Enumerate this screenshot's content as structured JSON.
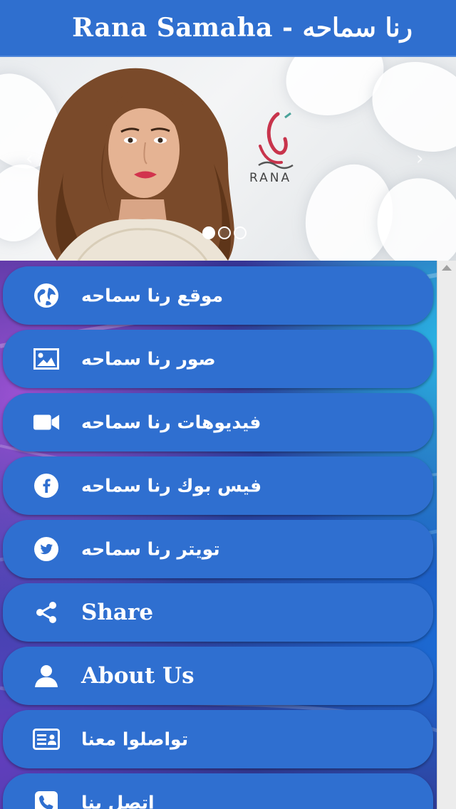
{
  "header": {
    "title": "Rana Samaha - رنا سماحه"
  },
  "slider": {
    "logo_text": "RANA",
    "prev_label": "‹",
    "next_label": "›",
    "dots": [
      {
        "active": true
      },
      {
        "active": false
      },
      {
        "active": false
      }
    ]
  },
  "menu": {
    "items": [
      {
        "label": "موقع رنا سماحه",
        "icon": "globe-icon"
      },
      {
        "label": "صور رنا سماحه",
        "icon": "image-icon"
      },
      {
        "label": "فيديوهات رنا سماحه",
        "icon": "video-camera-icon"
      },
      {
        "label": "فيس بوك رنا سماحه",
        "icon": "facebook-icon"
      },
      {
        "label": "تويتر رنا سماحه",
        "icon": "twitter-icon"
      },
      {
        "label": "Share",
        "icon": "share-icon"
      },
      {
        "label": "About Us",
        "icon": "user-icon"
      },
      {
        "label": "تواصلوا معنا",
        "icon": "contact-card-icon"
      },
      {
        "label": "اتصل بنا",
        "icon": "phone-icon"
      }
    ]
  },
  "colors": {
    "header_bg": "#2f6fcf",
    "button_bg": "#2f6fd0",
    "text": "#ffffff"
  }
}
